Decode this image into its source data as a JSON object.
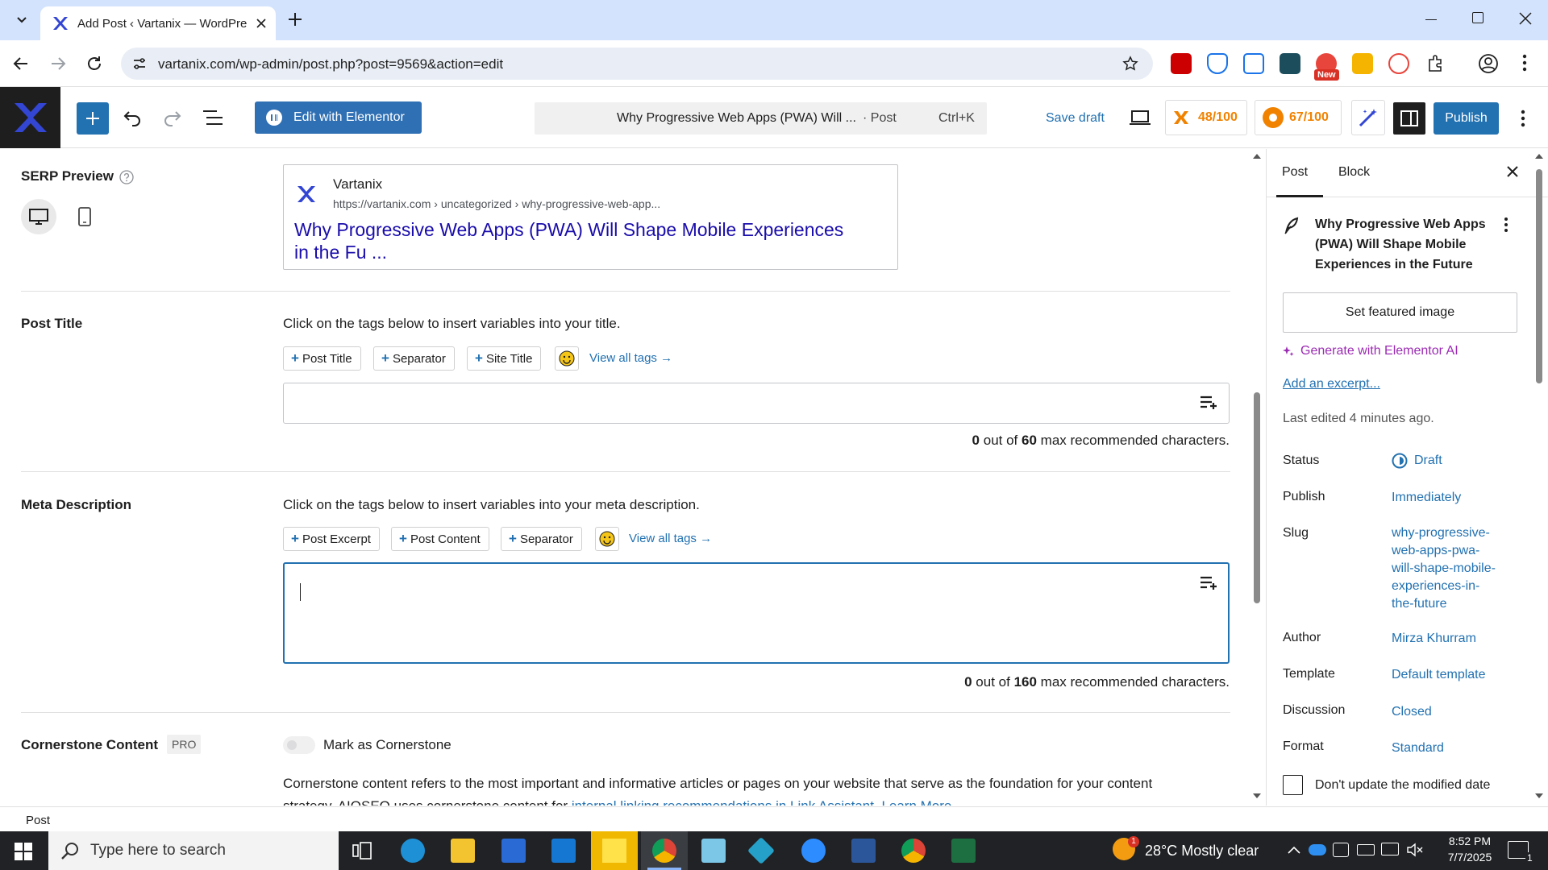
{
  "browser": {
    "tab_title": "Add Post ‹ Vartanix — WordPre",
    "url": "vartanix.com/wp-admin/post.php?post=9569&action=edit",
    "ext_badge": "New"
  },
  "toolbar": {
    "elementor_label": "Edit with Elementor",
    "cmd_title": "Why Progressive Web Apps (PWA) Will ...",
    "cmd_type": "· Post",
    "cmd_shortcut": "Ctrl+K",
    "save_draft": "Save draft",
    "score1": "48/100",
    "score2": "67/100",
    "publish": "Publish"
  },
  "serp": {
    "label": "SERP Preview",
    "site_name": "Vartanix",
    "site_url": "https://vartanix.com › uncategorized › why-progressive-web-app...",
    "title_line1": "Why Progressive Web Apps (PWA) Will Shape Mobile Experiences",
    "title_line2": "in the Fu ..."
  },
  "post_title": {
    "label": "Post Title",
    "hint": "Click on the tags below to insert variables into your title.",
    "tags": [
      "Post Title",
      "Separator",
      "Site Title"
    ],
    "view_all": "View all tags →",
    "count": "0",
    "max": "60",
    "counter_text_a": "out of",
    "counter_text_b": "max recommended characters."
  },
  "meta_desc": {
    "label": "Meta Description",
    "hint": "Click on the tags below to insert variables into your meta description.",
    "tags": [
      "Post Excerpt",
      "Post Content",
      "Separator"
    ],
    "view_all": "View all tags →",
    "count": "0",
    "max": "160",
    "counter_text_a": "out of",
    "counter_text_b": "max recommended characters."
  },
  "cornerstone": {
    "label": "Cornerstone Content",
    "badge": "PRO",
    "toggle_label": "Mark as Cornerstone",
    "desc_line1": "Cornerstone content refers to the most important and informative articles or pages on your website that serve as the foundation for your content",
    "desc_line2_a": "strategy. AIOSEO uses cornerstone content for",
    "desc_line2_link1": "internal linking recommendations in Link Assistant.",
    "desc_line2_link2": "Learn More →"
  },
  "sidebar": {
    "tab_post": "Post",
    "tab_block": "Block",
    "post_title": "Why Progressive Web Apps (PWA) Will Shape Mobile Experiences in the Future",
    "featured": "Set featured image",
    "generate": "Generate with Elementor AI",
    "excerpt": "Add an excerpt...",
    "last_edited": "Last edited 4 minutes ago.",
    "rows": [
      {
        "label": "Status",
        "value": "Draft"
      },
      {
        "label": "Publish",
        "value": "Immediately"
      },
      {
        "label": "Slug",
        "value": "why-progressive-web-apps-pwa-will-shape-mobile-experiences-in-the-future"
      },
      {
        "label": "Author",
        "value": "Mirza Khurram"
      },
      {
        "label": "Template",
        "value": "Default template"
      },
      {
        "label": "Discussion",
        "value": "Closed"
      },
      {
        "label": "Format",
        "value": "Standard"
      }
    ],
    "slug_lines": [
      "why-progressive-",
      "web-apps-pwa-",
      "will-shape-mobile-",
      "experiences-in-",
      "the-future"
    ],
    "dont_update": "Don't update the modified date"
  },
  "statusbar": {
    "breadcrumb": "Post"
  },
  "taskbar": {
    "search_placeholder": "Type here to search",
    "weather": "28°C  Mostly clear",
    "weather_badge": "1",
    "time": "8:52 PM",
    "date": "7/7/2025",
    "notif_count": "1"
  }
}
